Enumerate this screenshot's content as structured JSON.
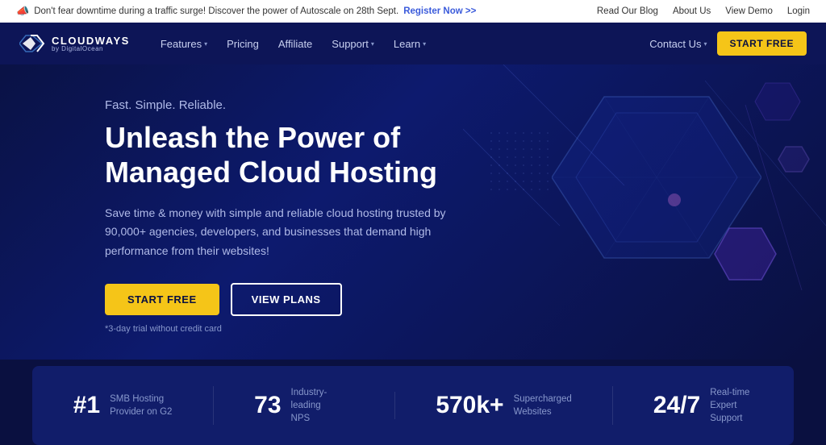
{
  "announcement": {
    "text": "Don't fear downtime during a traffic surge! Discover the power of Autoscale on 28th Sept.",
    "register_link": "Register Now >>",
    "right_links": [
      {
        "label": "Read Our Blog",
        "key": "read-blog"
      },
      {
        "label": "About Us",
        "key": "about-us"
      },
      {
        "label": "View Demo",
        "key": "view-demo"
      },
      {
        "label": "Login",
        "key": "login"
      }
    ]
  },
  "navbar": {
    "logo": {
      "brand": "CLOUDWAYS",
      "sub": "by DigitalOcean"
    },
    "nav_items": [
      {
        "label": "Features",
        "has_dropdown": true
      },
      {
        "label": "Pricing",
        "has_dropdown": false
      },
      {
        "label": "Affiliate",
        "has_dropdown": false
      },
      {
        "label": "Support",
        "has_dropdown": true
      },
      {
        "label": "Learn",
        "has_dropdown": true
      }
    ],
    "contact_us": "Contact Us",
    "start_free": "START FREE"
  },
  "hero": {
    "tagline": "Fast. Simple. Reliable.",
    "title": "Unleash the Power of\nManaged Cloud Hosting",
    "description": "Save time & money with simple and reliable cloud hosting trusted by 90,000+ agencies, developers, and businesses that demand high performance from their websites!",
    "btn_start": "START FREE",
    "btn_plans": "VIEW PLANS",
    "trial_note": "*3-day trial without credit card"
  },
  "stats": [
    {
      "number": "#1",
      "label": "SMB Hosting\nProvider on G2"
    },
    {
      "number": "73",
      "label": "Industry-leading\nNPS"
    },
    {
      "number": "570k+",
      "label": "Supercharged\nWebsites"
    },
    {
      "number": "24/7",
      "label": "Real-time\nExpert Support"
    }
  ],
  "colors": {
    "accent_yellow": "#f5c518",
    "navy_dark": "#0a1040",
    "navy_mid": "#0d1557",
    "stats_bg": "#111d6a"
  }
}
